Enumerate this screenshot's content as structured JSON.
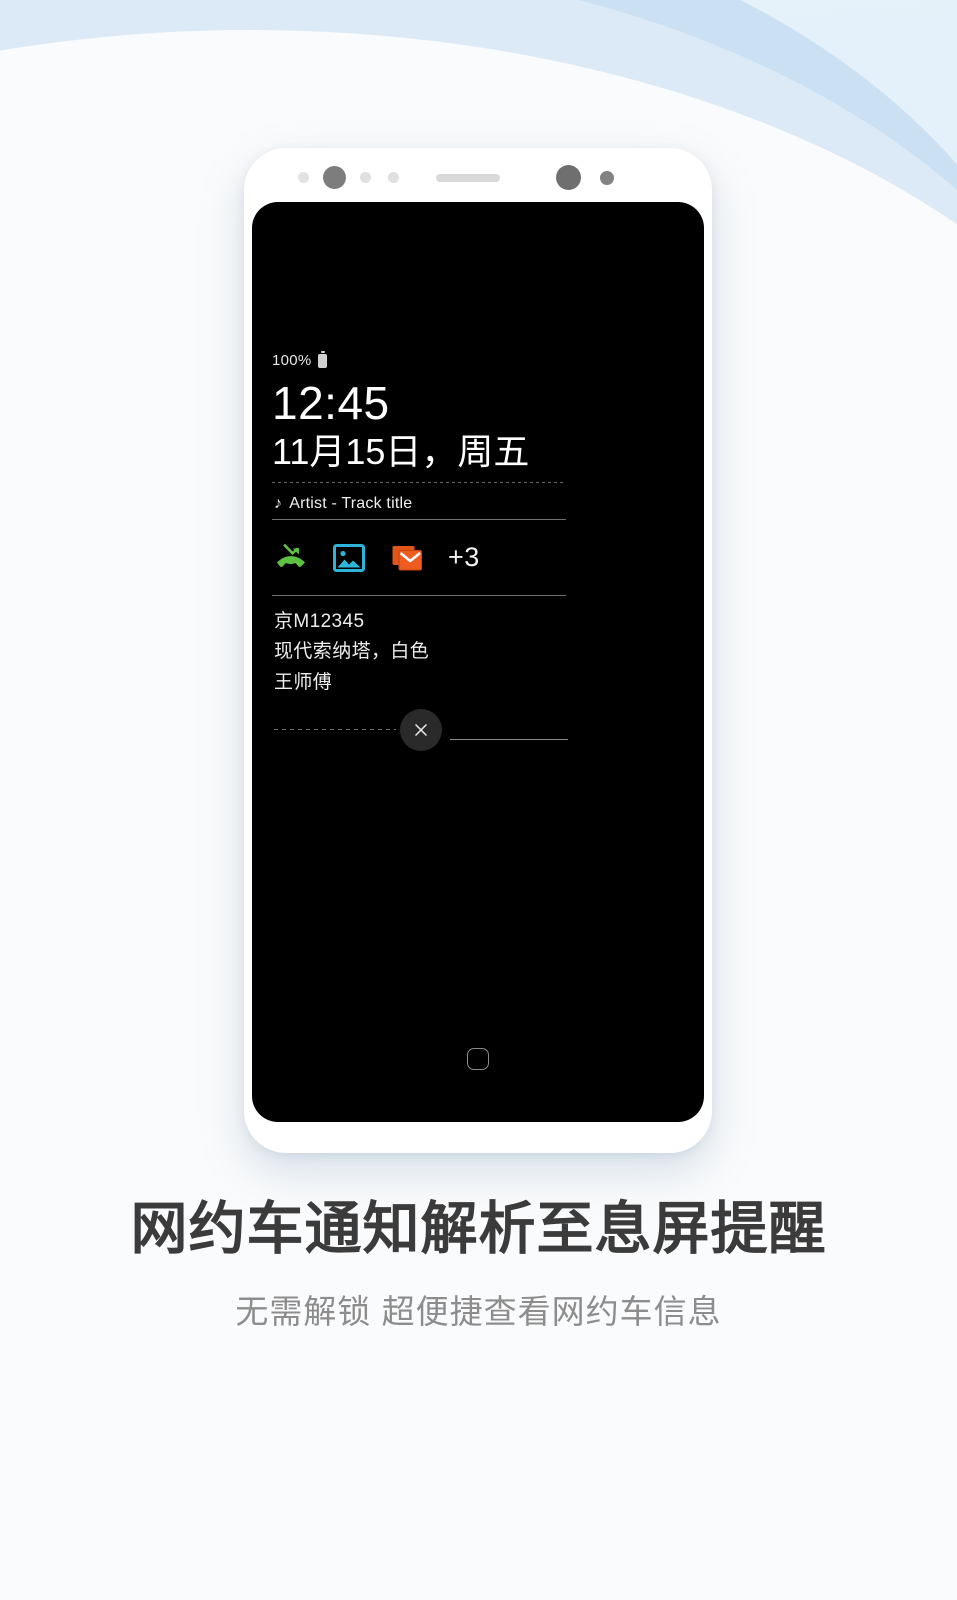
{
  "background": {
    "sky_color": "#e4f1f9",
    "wave_dark_color": "#c9dff2",
    "wave_light_color": "#dceaf7",
    "base_color": "#fafbfc"
  },
  "device": {
    "frame_color": "#ffffff",
    "screen_color": "#000000",
    "sensors": [
      "proximity-sensor",
      "front-camera",
      "light-sensor",
      "iris-sensor",
      "earpiece-speaker",
      "selfie-camera",
      "led-indicator"
    ],
    "home_indicator": "home-button-outline"
  },
  "always_on_display": {
    "battery_percent": "100%",
    "battery_icon": "battery-full-icon",
    "clock": "12:45",
    "date": "11月15日，周五",
    "music": {
      "note_icon": "♪",
      "text": "Artist - Track title"
    },
    "notifications": {
      "icons": [
        {
          "name": "missed-call-icon",
          "color": "#5dc243"
        },
        {
          "name": "gallery-image-icon",
          "color": "#2eb4d8"
        },
        {
          "name": "email-icon",
          "color": "#e2551b"
        }
      ],
      "overflow_count": "+3"
    },
    "ride_info": {
      "plate": "京M12345",
      "vehicle": "现代索纳塔，白色",
      "driver": "王师傅",
      "dismiss_icon": "close-x-icon"
    }
  },
  "caption": {
    "headline": "网约车通知解析至息屏提醒",
    "subline": "无需解锁 超便捷查看网约车信息",
    "headline_color": "#3b3b3b",
    "subline_color": "#8d8d8d"
  }
}
